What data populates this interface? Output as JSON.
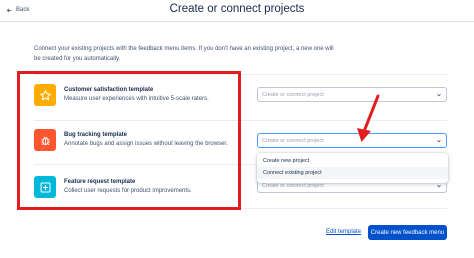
{
  "header": {
    "back_label": "Back",
    "title": "Create or connect projects"
  },
  "intro_text": "Connect your existing projects with the feedback menu items. If you don't have an existing project, a new one will be created for you automatically.",
  "templates": [
    {
      "title": "Customer satisfaction template",
      "description": "Measure user experiences with intuitive 5-scale raters.",
      "icon": "star-icon",
      "color": "#ffab00"
    },
    {
      "title": "Bug tracking template",
      "description": "Annotate bugs and assign issues without leaving the browser.",
      "icon": "bug-icon",
      "color": "#ff5630"
    },
    {
      "title": "Feature request template",
      "description": "Collect user requests for product improvements.",
      "icon": "plus-square-icon",
      "color": "#00b8d9"
    }
  ],
  "selects": [
    {
      "placeholder": "Create or connect project"
    },
    {
      "placeholder": "Create or connect project"
    },
    {
      "placeholder": "Create or connect project"
    }
  ],
  "dropdown_options": [
    "Create new project",
    "Connect existing project"
  ],
  "footer": {
    "edit_link": "Edit template",
    "primary_button": "Create new feedback menu"
  },
  "colors": {
    "accent": "#0052cc",
    "highlight_annotation": "#e11d1d"
  }
}
